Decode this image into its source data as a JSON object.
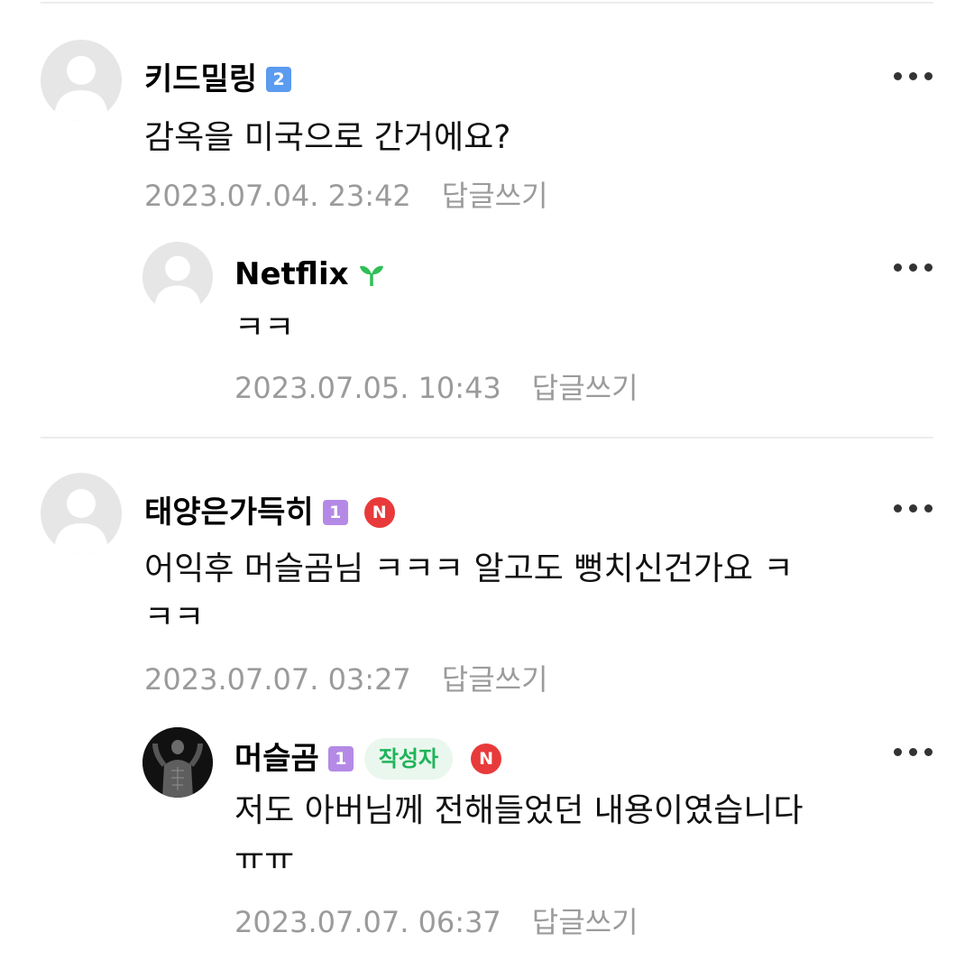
{
  "comments": [
    {
      "author": "키드밀링",
      "level": "2",
      "text": "감옥을 미국으로 간거에요?",
      "date": "2023.07.04. 23:42",
      "reply_label": "답글쓰기",
      "replies": [
        {
          "author": "Netflix",
          "level_icon": "sprout-icon",
          "text": "ㅋㅋ",
          "date": "2023.07.05. 10:43",
          "reply_label": "답글쓰기"
        }
      ]
    },
    {
      "author": "태양은가득히",
      "level": "1",
      "badge": "N",
      "text": "어익후 머슬곰님 ㅋㅋㅋ 알고도 뻥치신건가요 ㅋ\nㅋㅋ",
      "date": "2023.07.07. 03:27",
      "reply_label": "답글쓰기",
      "replies": [
        {
          "author": "머슬곰",
          "level": "1",
          "author_badge": "작성자",
          "badge": "N",
          "text": "저도 아버님께 전해들었던 내용이였습니다\nㅠㅠ",
          "date": "2023.07.07. 06:37",
          "reply_label": "답글쓰기"
        }
      ]
    }
  ],
  "colors": {
    "level_blue": "#5b9bf0",
    "level_purple": "#b48ae6",
    "new_badge": "#e83a3a",
    "author_badge_text": "#1fb45a",
    "meta_text": "#9b9b9b"
  }
}
